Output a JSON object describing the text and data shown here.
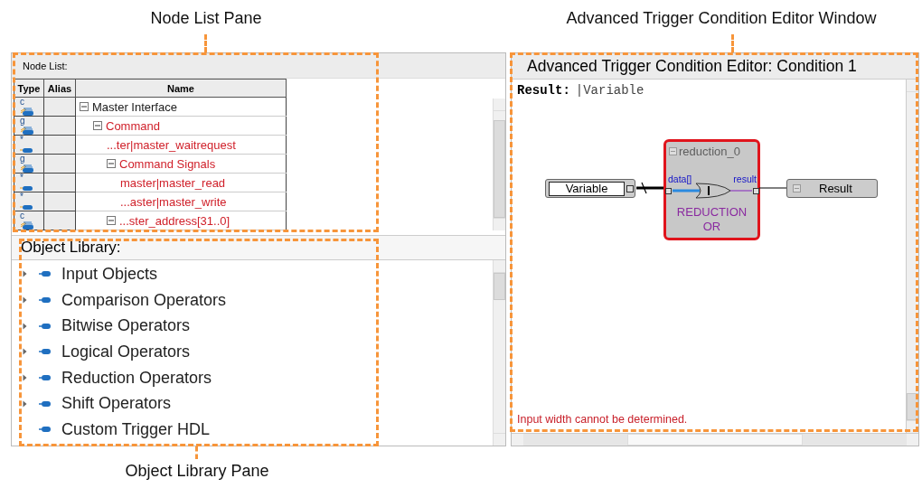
{
  "callouts": [
    {
      "label": "Node List Pane"
    },
    {
      "label": "Advanced Trigger Condition Editor Window"
    },
    {
      "label": "Object Library Pane"
    }
  ],
  "node_list": {
    "title": "Node List:",
    "columns": [
      "Type",
      "Alias",
      "Name"
    ],
    "rows": [
      {
        "type": "c",
        "kind": "bus",
        "name": "Master Interface",
        "color": "#1a1a1a",
        "expanded": true,
        "children": [
          {
            "type": "g",
            "kind": "bus",
            "name": "Command",
            "color": "#d0202a",
            "expanded": true,
            "children": [
              {
                "type": "*",
                "kind": "signal",
                "name": "...ter|master_waitrequest",
                "color": "#d0202a"
              },
              {
                "type": "g",
                "kind": "bus",
                "name": "Command Signals",
                "color": "#d0202a",
                "expanded": true,
                "children": [
                  {
                    "type": "*",
                    "kind": "signal",
                    "name": "master|master_read",
                    "color": "#d0202a"
                  },
                  {
                    "type": "*",
                    "kind": "signal",
                    "name": "...aster|master_write",
                    "color": "#d0202a"
                  }
                ]
              },
              {
                "type": "c",
                "kind": "bus",
                "name": "...ster_address[31..0]",
                "color": "#d0202a",
                "expanded": true
              }
            ]
          }
        ]
      }
    ]
  },
  "object_library": {
    "title": "Object Library:",
    "items": [
      {
        "label": "Input Objects",
        "kind": "group"
      },
      {
        "label": "Comparison Operators",
        "kind": "group"
      },
      {
        "label": "Bitwise Operators",
        "kind": "group"
      },
      {
        "label": "Logical Operators",
        "kind": "group"
      },
      {
        "label": "Reduction Operators",
        "kind": "group"
      },
      {
        "label": "Shift Operators",
        "kind": "group"
      },
      {
        "label": "Custom Trigger HDL",
        "kind": "item"
      }
    ]
  },
  "editor": {
    "title": "Advanced Trigger Condition Editor: Condition 1",
    "result_label": "Result:",
    "result_value": "|Variable",
    "diagram": {
      "input": "Variable",
      "block": {
        "name": "reduction_0",
        "input_port": "data[]",
        "output_port": "result",
        "label": "REDUCTION OR"
      },
      "output": "Result"
    },
    "message": "Input width cannot be determined."
  }
}
